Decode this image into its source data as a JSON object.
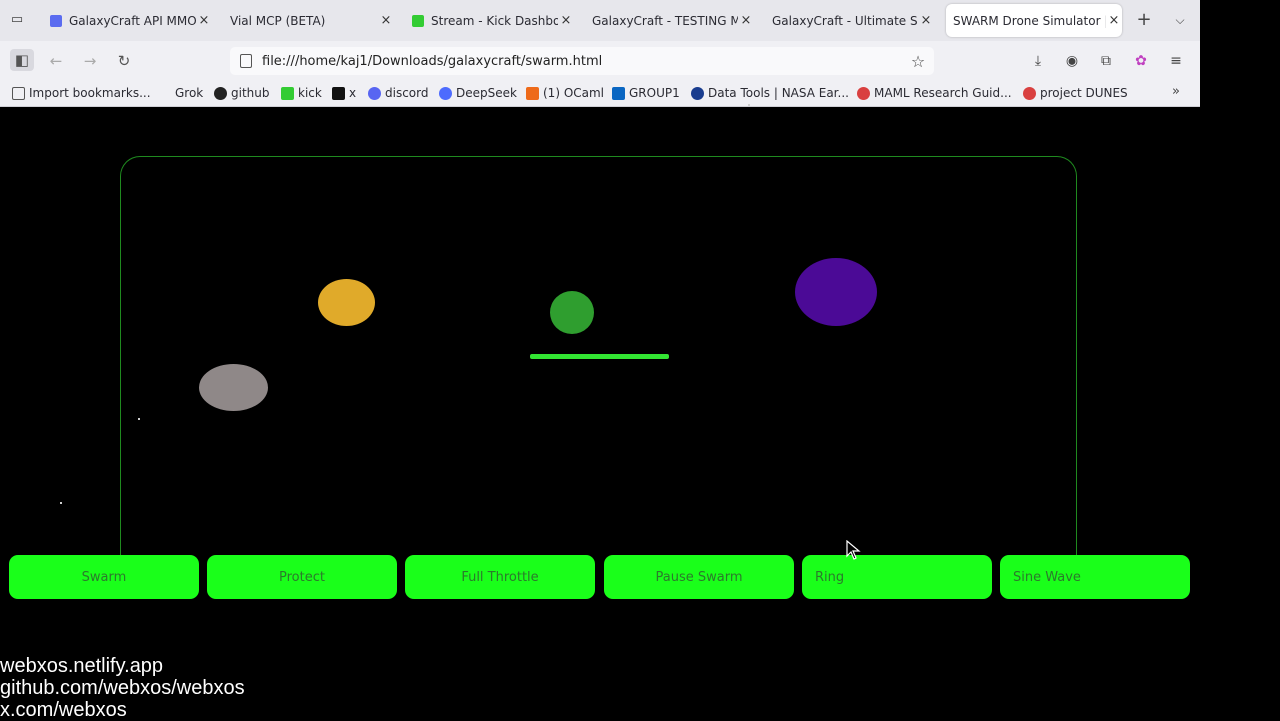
{
  "browser": {
    "tabs": [
      {
        "title": "GalaxyCraft API MMO (",
        "favicon_color": "#5b6cf0",
        "active": false
      },
      {
        "title": "Vial MCP (BETA)",
        "favicon_color": "",
        "active": false
      },
      {
        "title": "Stream - Kick Dashboar",
        "favicon_color": "#33cc33",
        "active": false
      },
      {
        "title": "GalaxyCraft - TESTING MC",
        "favicon_color": "",
        "active": false
      },
      {
        "title": "GalaxyCraft - Ultimate Spa",
        "favicon_color": "",
        "active": false
      },
      {
        "title": "SWARM Drone Simulator |",
        "favicon_color": "",
        "active": true
      }
    ],
    "close_glyph": "×",
    "new_tab_glyph": "+",
    "url": "file:///home/kaj1/Downloads/galaxycraft/swarm.html",
    "bookmarks": [
      {
        "label": "Import bookmarks...",
        "icon_color": "#555555"
      },
      {
        "label": "Grok",
        "icon_color": ""
      },
      {
        "label": "github",
        "icon_color": "#222222"
      },
      {
        "label": "kick",
        "icon_color": "#33cc33"
      },
      {
        "label": "x",
        "icon_color": "#111111"
      },
      {
        "label": "discord",
        "icon_color": "#5865f2"
      },
      {
        "label": "DeepSeek",
        "icon_color": "#4d6bfe"
      },
      {
        "label": "(1) OCaml",
        "icon_color": "#ee6a1a"
      },
      {
        "label": "GROUP1",
        "icon_color": "#0a66c2"
      },
      {
        "label": "Data Tools | NASA Ear...",
        "icon_color": "#1a3d8f"
      },
      {
        "label": "MAML Research Guid...",
        "icon_color": "#d94040"
      },
      {
        "label": "project DUNES",
        "icon_color": "#d94040"
      }
    ]
  },
  "simulator": {
    "drones": [
      {
        "name": "yellow",
        "color": "#e0aa2a"
      },
      {
        "name": "green",
        "color": "#2f9e2f"
      },
      {
        "name": "purple",
        "color": "#4b0a96"
      },
      {
        "name": "gray",
        "color": "#8f8888"
      }
    ],
    "accent_color": "#1aff1a",
    "buttons": {
      "swarm": "Swarm",
      "protect": "Protect",
      "full_throttle": "Full Throttle",
      "pause_swarm": "Pause Swarm",
      "ring": "Ring",
      "sine_wave": "Sine Wave"
    }
  },
  "footer": {
    "line1": "webxos.netlify.app",
    "line2": "github.com/webxos/webxos",
    "line3": "x.com/webxos"
  }
}
